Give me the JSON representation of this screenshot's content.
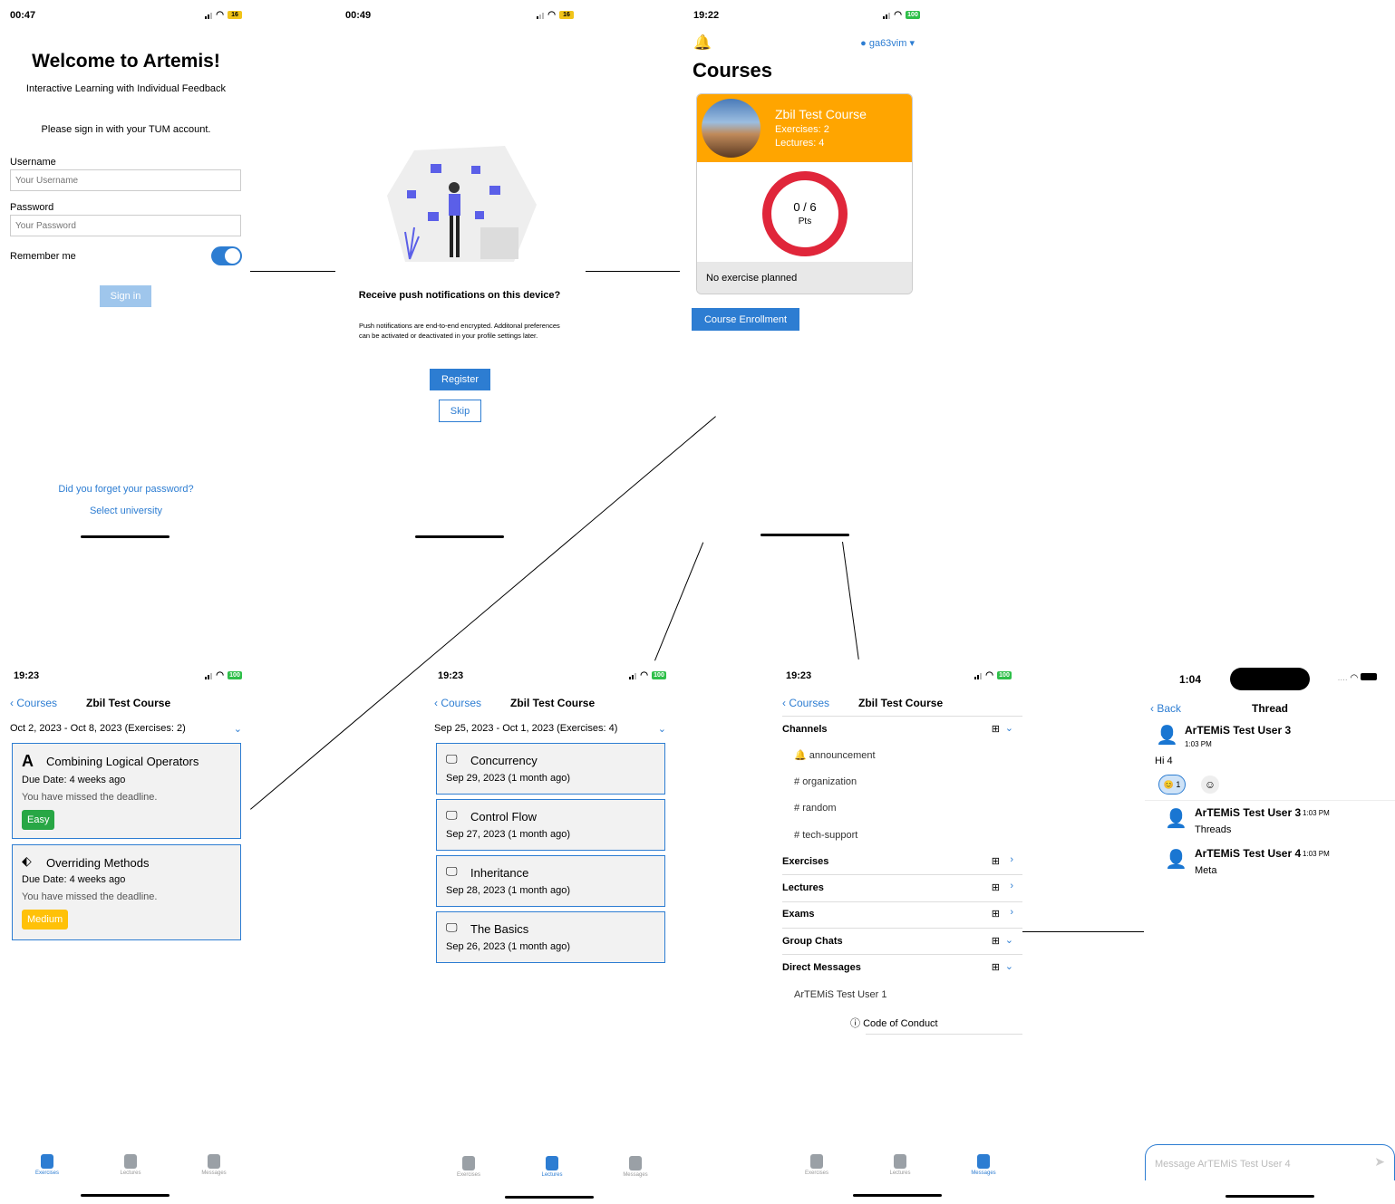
{
  "login": {
    "time": "00:47",
    "battery": "16",
    "title": "Welcome to Artemis!",
    "subtitle": "Interactive Learning with Individual Feedback",
    "prompt": "Please sign in with your TUM account.",
    "username_label": "Username",
    "username_placeholder": "Your Username",
    "password_label": "Password",
    "password_placeholder": "Your Password",
    "remember_label": "Remember me",
    "sign_in": "Sign in",
    "forgot": "Did you forget your password?",
    "select_university": "Select university"
  },
  "push": {
    "time": "00:49",
    "battery": "16",
    "heading": "Receive push notifications on this device?",
    "body": "Push notifications are end-to-end encrypted. Additonal preferences can be activated or deactivated in your profile settings later.",
    "register": "Register",
    "skip": "Skip"
  },
  "courses": {
    "time": "19:22",
    "battery": "100",
    "user": "ga63vim",
    "title": "Courses",
    "card": {
      "name": "Zbil Test Course",
      "exercises": "Exercises: 2",
      "lectures": "Lectures: 4",
      "score": "0 / 6",
      "unit": "Pts",
      "footer": "No exercise planned"
    },
    "enroll": "Course Enrollment"
  },
  "exercises": {
    "time": "19:23",
    "battery": "100",
    "back": "Courses",
    "title": "Zbil Test Course",
    "week": "Oct 2, 2023 - Oct 8, 2023 (Exercises: 2)",
    "items": [
      {
        "name": "Combining Logical Operators",
        "due": "Due Date: 4 weeks ago",
        "note": "You have missed the deadline.",
        "badge": "Easy"
      },
      {
        "name": "Overriding Methods",
        "due": "Due Date: 4 weeks ago",
        "note": "You have missed the deadline.",
        "badge": "Medium"
      }
    ]
  },
  "lectures": {
    "time": "19:23",
    "battery": "100",
    "back": "Courses",
    "title": "Zbil Test Course",
    "week": "Sep 25, 2023 - Oct 1, 2023 (Exercises: 4)",
    "items": [
      {
        "name": "Concurrency",
        "date": "Sep 29, 2023 (1 month ago)"
      },
      {
        "name": "Control Flow",
        "date": "Sep 27, 2023 (1 month ago)"
      },
      {
        "name": "Inheritance",
        "date": "Sep 28, 2023 (1 month ago)"
      },
      {
        "name": "The Basics",
        "date": "Sep 26, 2023 (1 month ago)"
      }
    ]
  },
  "messages": {
    "time": "19:23",
    "battery": "100",
    "back": "Courses",
    "title": "Zbil Test Course",
    "channels_header": "Channels",
    "channels": [
      "announcement",
      "organization",
      "random",
      "tech-support"
    ],
    "sections": [
      "Exercises",
      "Lectures",
      "Exams",
      "Group Chats",
      "Direct Messages"
    ],
    "dm": "ArTEMiS Test User 1",
    "code_of_conduct": "Code of Conduct"
  },
  "tabs": {
    "exercises": "Exercises",
    "lectures": "Lectures",
    "messages": "Messages"
  },
  "thread": {
    "time": "1:04",
    "back": "Back",
    "title": "Thread",
    "author": "ArTEMiS Test User 3",
    "author_time": "1:03 PM",
    "text": "Hi 4",
    "reaction_count": "1",
    "replies": [
      {
        "author": "ArTEMiS Test User 3",
        "time": "1:03 PM",
        "text": "Threads"
      },
      {
        "author": "ArTEMiS Test User 4",
        "time": "1:03 PM",
        "text": "Meta"
      }
    ],
    "input_placeholder": "Message ArTEMiS Test User 4"
  },
  "colors": {
    "accent": "#2d7dd2",
    "course_card": "#ffa500",
    "ring": "#e0263a",
    "easy": "#28a745",
    "medium": "#ffc107"
  }
}
